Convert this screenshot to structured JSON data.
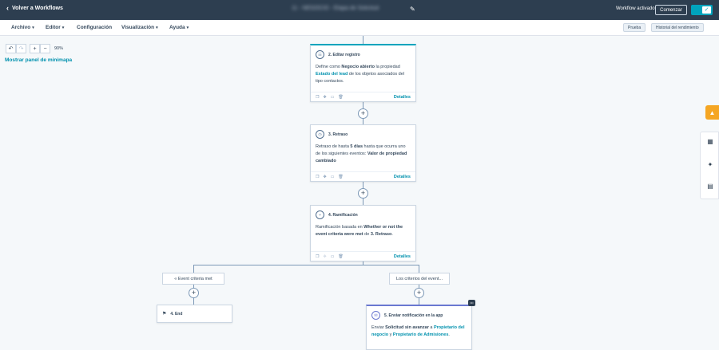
{
  "topbar": {
    "back_label": "Volver a Workflows",
    "workflow_title": "11 - NEGOCIO - Etapa de Solicitud",
    "status": "Workflow activado",
    "start_button": "Comenzar"
  },
  "menu": {
    "items": [
      "Archivo",
      "Editor",
      "Configuración",
      "Visualización",
      "Ayuda"
    ],
    "test_button": "Prueba",
    "history_button": "Historial del rendimiento"
  },
  "canvas": {
    "zoom": "90%",
    "minimap_link": "Mostrar panel de minimapa"
  },
  "cards": {
    "editor": {
      "title": "2. Editar registro",
      "pre": "Define como ",
      "bold1": "Negocio abierto",
      "mid": " la propiedad ",
      "link1": "Estado del lead",
      "post": " de los objetos asociados del tipo contactos.",
      "details": "Detalles"
    },
    "delay": {
      "title": "3. Retraso",
      "pre": "Retraso de hasta ",
      "bold1": "5 días",
      "mid": " hasta que ocurra uno de los siguientes eventos: ",
      "bold2": "Valor de propiedad cambiado",
      "details": "Detalles"
    },
    "branch": {
      "title": "4. Ramificación",
      "pre": "Ramificación basada en ",
      "bold1": "Whether or not the event criteria were met",
      "mid": " de ",
      "bold2": "3. Retraso",
      "post": ".",
      "details": "Detalles"
    },
    "end": {
      "title": "4. End"
    },
    "notify": {
      "title": "5. Enviar notificación en la app",
      "pre": "Enviar ",
      "bold1": "Solicitud sin avanzar",
      "mid": " a ",
      "link1": "Propietario del negocio",
      "mid2": " y ",
      "link2": "Propietario de Admisiones",
      "post": "."
    }
  },
  "branches": {
    "left": "« Event criteria met",
    "right": "Los criterios del event..."
  },
  "colors": {
    "topbar": "#2d3e50",
    "accent": "#00a4bd",
    "link": "#0091ae",
    "notify_accent": "#6a78d1"
  },
  "icons": [
    "undo-icon",
    "redo-icon",
    "zoom-in-icon",
    "zoom-out-icon",
    "pencil-icon",
    "check-icon",
    "copy-icon",
    "move-icon",
    "clone-icon",
    "delete-icon",
    "flag-icon"
  ]
}
